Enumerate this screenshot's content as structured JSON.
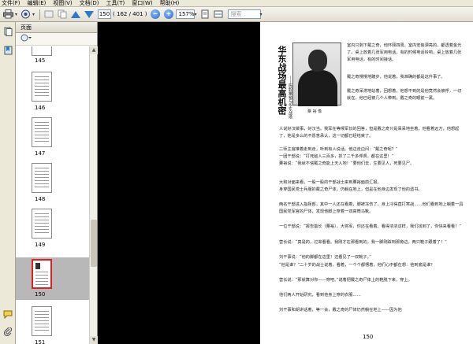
{
  "menu": [
    "文件(F)",
    "编辑(E)",
    "视图(V)",
    "文档(D)",
    "工具(T)",
    "窗口(W)",
    "帮助(H)"
  ],
  "toolbar": {
    "page_value": "150",
    "page_count": "( 162 / 401 )",
    "zoom_value": "157%",
    "search_placeholder": "搜索"
  },
  "panel": {
    "title": "页面"
  },
  "thumbnails": [
    {
      "label": "145",
      "selected": false
    },
    {
      "label": "146",
      "selected": false
    },
    {
      "label": "147",
      "selected": false
    },
    {
      "label": "148",
      "selected": false
    },
    {
      "label": "149",
      "selected": false
    },
    {
      "label": "150",
      "selected": true
    },
    {
      "label": "151",
      "selected": false
    }
  ],
  "document": {
    "vertical_title": "华东战场最高机密",
    "vertical_subtitle": "——陈毅粟裕与华东战场",
    "photo_caption": "粟 裕 像",
    "page_number": "150",
    "paragraphs": [
      "室内只剩下戴之奇，他环顾四周，室内安装漂亮的，都透着金光了。桌上放着几张军用电话，有的时候电话铃响，桌上放着几张军用电话，有的时间接话。",
      "戴之奇慢慢地踱步，他说着，我准确的都是这件事了。",
      "戴之奇呆滞地站着，回想着，他想不到的是他竟然会被俘，一切就在，他已经被几个人带到，戴之奇的眼前一黑。",
      "人说好汉做事，好汉当。我军在等候军长的回答，但是戴之奇只是呆呆地坐着，他看着远方，他想起了，他是多么的不愿意承认，这一切都已经结束了。",
      "二师主官推着走到走，听到有人说话。他边走边问：“戴之奇呢？”",
      "一团干部说：“打死敌人三百多，抓了二千多俘虏，都在这里！”",
      "粟裕说：“我就不信戴之奇能上天入地！”要他们去，生要见人，死要见尸。",
      "大和对面来看，一股一股的干部战士来到粟裕面前汇报。",
      "身穿国民党士兵服的戴之奇尸体，仍躺在地上，但是在他身边发现了他的遗书。",
      "两名干部进入指挥部，其中一人还在看着，脚被冻伤了，身上冷得直打寒战……他们看到地上躺着一具国民党军官的尸体，发现他脚上穿着一双高筒马靴。",
      "一位干部说：“报告首长（粟裕），大将军，你还在看着。看得浓浓这样，我们找到了，你快来看看！”",
      "营长说：“真是的，过来看看。我刚才在那看到的，我一脚刚踩到那旁边，两只鞋子跟着了！”",
      "刘干事说：“他的脚都在这里！还看见了一双靴子。”",
      "“他是谁？”二十岁的战士说着，看着，一个个都愣着，他们心中都在想：他到底是谁？",
      "营长说：“那就算对你——穿吧。”说着把戴之奇尸体上的鞋脱下来，穿上。",
      "他们两人开始研究，看到他身上穿的衣服……",
      "刘干事和胡讲话着，等一会，戴之奇的尸体仍然躺在地上——因为他"
    ]
  },
  "colors": {
    "selection_border": "#e02020",
    "doc_background": "#808080",
    "toolbar_blue": "#2f7ac8"
  }
}
